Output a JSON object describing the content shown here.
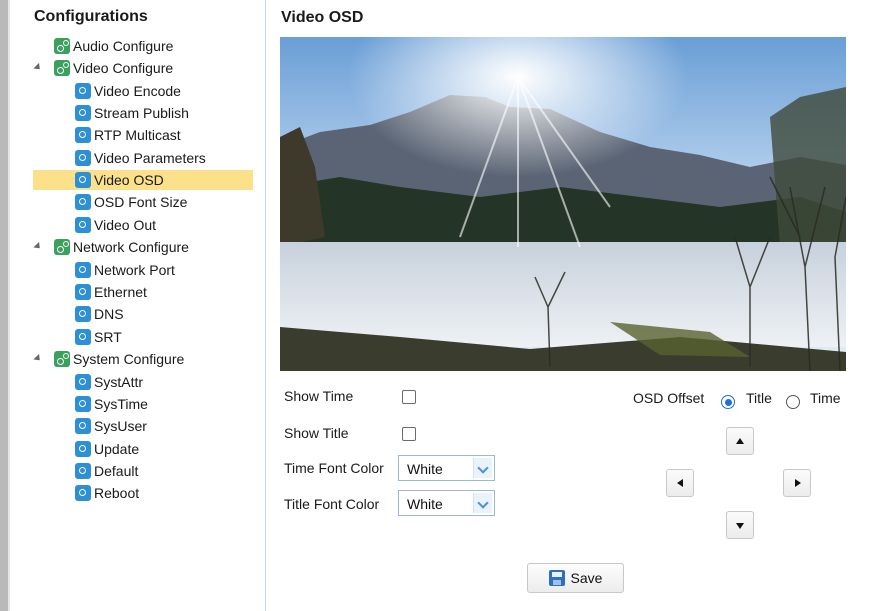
{
  "sidebar": {
    "title": "Configurations",
    "items": [
      {
        "label": "Audio Configure",
        "icon": "settings-folder-icon"
      },
      {
        "label": "Video Configure",
        "icon": "settings-folder-icon"
      },
      {
        "label": "Video Encode",
        "icon": "page-icon"
      },
      {
        "label": "Stream Publish",
        "icon": "page-icon"
      },
      {
        "label": "RTP Multicast",
        "icon": "page-icon"
      },
      {
        "label": "Video Parameters",
        "icon": "page-icon"
      },
      {
        "label": "Video OSD",
        "icon": "page-icon",
        "selected": true
      },
      {
        "label": "OSD Font Size",
        "icon": "page-icon"
      },
      {
        "label": "Video Out",
        "icon": "page-icon"
      },
      {
        "label": "Network Configure",
        "icon": "settings-folder-icon"
      },
      {
        "label": "Network Port",
        "icon": "page-icon"
      },
      {
        "label": "Ethernet",
        "icon": "page-icon"
      },
      {
        "label": "DNS",
        "icon": "page-icon"
      },
      {
        "label": "SRT",
        "icon": "page-icon"
      },
      {
        "label": "System Configure",
        "icon": "settings-folder-icon"
      },
      {
        "label": "SystAttr",
        "icon": "page-icon"
      },
      {
        "label": "SysTime",
        "icon": "page-icon"
      },
      {
        "label": "SysUser",
        "icon": "page-icon"
      },
      {
        "label": "Update",
        "icon": "page-icon"
      },
      {
        "label": "Default",
        "icon": "page-icon"
      },
      {
        "label": "Reboot",
        "icon": "page-icon"
      }
    ]
  },
  "main": {
    "title": "Video OSD",
    "form": {
      "show_time_label": "Show Time",
      "show_time_checked": false,
      "show_title_label": "Show Title",
      "show_title_checked": false,
      "time_font_color_label": "Time Font Color",
      "time_font_color_value": "White",
      "title_font_color_label": "Title Font Color",
      "title_font_color_value": "White"
    },
    "osd_offset": {
      "label": "OSD Offset",
      "options": [
        "Title",
        "Time"
      ],
      "selected": "Title"
    },
    "save_label": "Save"
  },
  "colors": {
    "selection": "#fde08a",
    "accent": "#1e6fd9",
    "folder_icon": "#3aa15d",
    "page_icon": "#2d8fd4"
  }
}
